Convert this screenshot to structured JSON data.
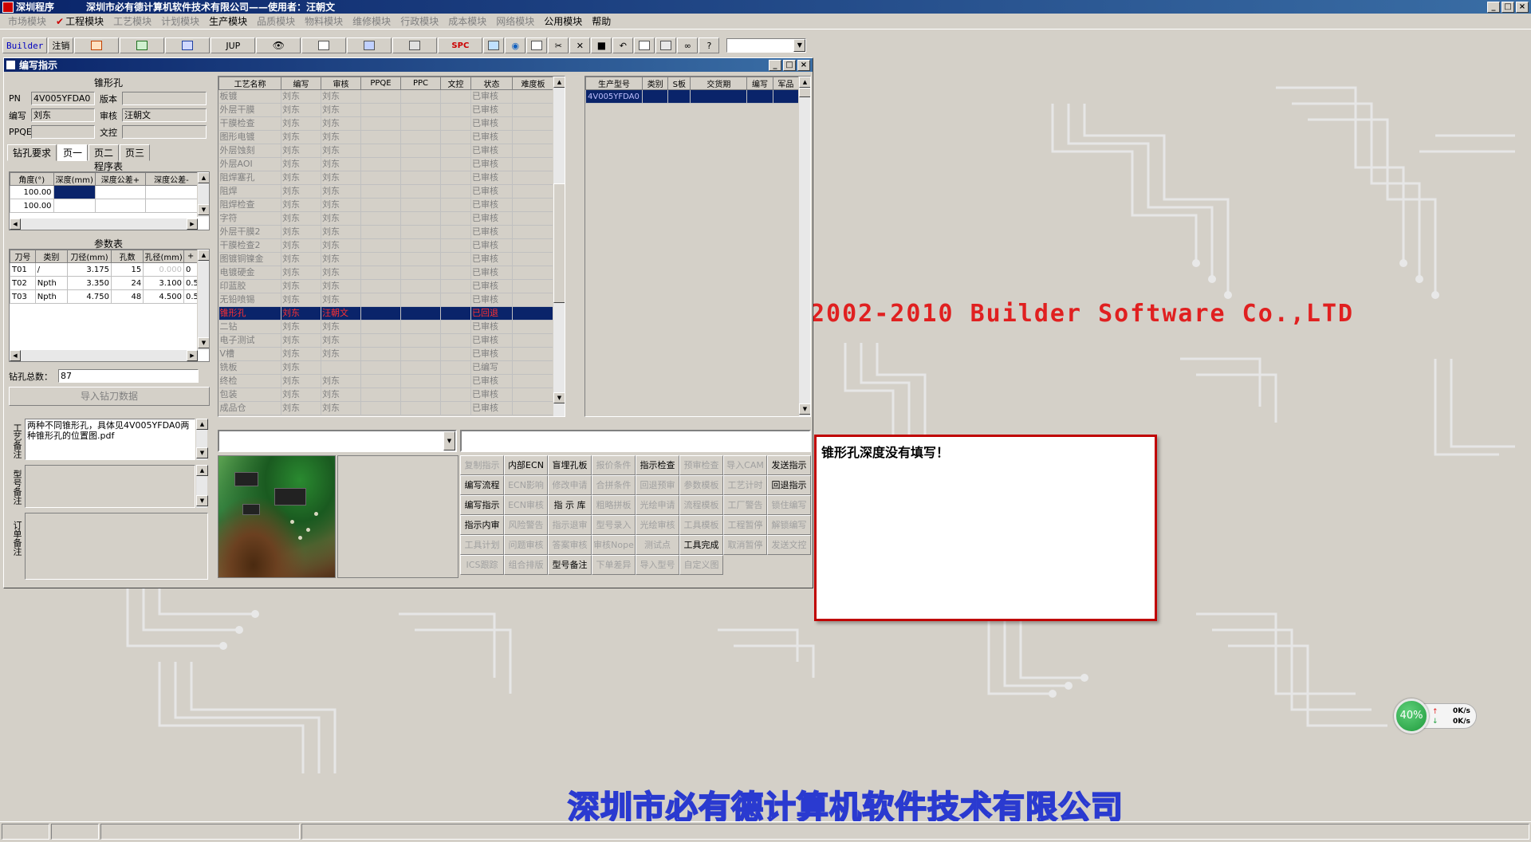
{
  "app": {
    "name": "深圳程序",
    "caption": "深圳市必有德计算机软件技术有限公司——使用者：汪朝文"
  },
  "window_buttons": [
    "_",
    "□",
    "×"
  ],
  "menu": [
    {
      "label": "市场模块",
      "active": false
    },
    {
      "label": "工程模块",
      "active": true,
      "checked": true
    },
    {
      "label": "工艺模块",
      "active": false
    },
    {
      "label": "计划模块",
      "active": false
    },
    {
      "label": "生产模块",
      "active": true
    },
    {
      "label": "品质模块",
      "active": false
    },
    {
      "label": "物料模块",
      "active": false
    },
    {
      "label": "维修模块",
      "active": false
    },
    {
      "label": "行政模块",
      "active": false
    },
    {
      "label": "成本模块",
      "active": false
    },
    {
      "label": "网络模块",
      "active": false
    },
    {
      "label": "公用模块",
      "active": true
    },
    {
      "label": "帮助",
      "active": true
    }
  ],
  "toolbar": {
    "builder_label": "Builder",
    "logout_label": "注销",
    "jup_label": "JUP",
    "spc_label": "SPC"
  },
  "child_window": {
    "title": "编写指示",
    "buttons": [
      "_",
      "□",
      "×"
    ]
  },
  "left": {
    "header": "锥形孔",
    "pn_label": "PN",
    "pn_value": "4V005YFDA0",
    "version_label": "版本",
    "version_value": "",
    "author_label": "编写",
    "author_value": "刘东",
    "reviewer_label": "审核",
    "reviewer_value": "汪朝文",
    "ppqe_label": "PPQE",
    "ppqe_value": "",
    "doc_label": "文控",
    "doc_value": "",
    "tabs": [
      "钻孔要求",
      "页一",
      "页二",
      "页三"
    ],
    "program_table_title": "程序表",
    "program_columns": [
      "角度(°)",
      "深度(mm)",
      "深度公差+",
      "深度公差-"
    ],
    "program_rows": [
      [
        "100.00",
        "",
        "",
        ""
      ],
      [
        "100.00",
        "",
        "",
        ""
      ]
    ],
    "param_table_title": "参数表",
    "param_columns": [
      "刀号",
      "类别",
      "刀径(mm)",
      "孔数",
      "孔径(mm)",
      "+"
    ],
    "param_rows": [
      [
        "T01",
        "/",
        "3.175",
        "15",
        "0.000",
        "0"
      ],
      [
        "T02",
        "Npth",
        "3.350",
        "24",
        "3.100",
        "0.5"
      ],
      [
        "T03",
        "Npth",
        "4.750",
        "48",
        "4.500",
        "0.5"
      ]
    ],
    "total_holes_label": "钻孔总数：",
    "total_holes_value": "87",
    "import_button": "导入钻刀数据",
    "note1_label": "工艺备注",
    "note1_text": "两种不同锥形孔，具体见4V005YFDA0两种锥形孔的位置图.pdf",
    "note2_label": "型号备注",
    "note3_label": "订单备注"
  },
  "process_grid": {
    "columns": [
      "工艺名称",
      "编写",
      "审核",
      "PPQE",
      "PPC",
      "文控",
      "状态",
      "难度板"
    ],
    "rows": [
      [
        "板镀",
        "刘东",
        "刘东",
        "",
        "",
        "",
        "已审核",
        ""
      ],
      [
        "外层干膜",
        "刘东",
        "刘东",
        "",
        "",
        "",
        "已审核",
        ""
      ],
      [
        "干膜检查",
        "刘东",
        "刘东",
        "",
        "",
        "",
        "已审核",
        ""
      ],
      [
        "图形电镀",
        "刘东",
        "刘东",
        "",
        "",
        "",
        "已审核",
        ""
      ],
      [
        "外层蚀刻",
        "刘东",
        "刘东",
        "",
        "",
        "",
        "已审核",
        ""
      ],
      [
        "外层AOI",
        "刘东",
        "刘东",
        "",
        "",
        "",
        "已审核",
        ""
      ],
      [
        "阻焊塞孔",
        "刘东",
        "刘东",
        "",
        "",
        "",
        "已审核",
        ""
      ],
      [
        "阻焊",
        "刘东",
        "刘东",
        "",
        "",
        "",
        "已审核",
        ""
      ],
      [
        "阻焊检查",
        "刘东",
        "刘东",
        "",
        "",
        "",
        "已审核",
        ""
      ],
      [
        "字符",
        "刘东",
        "刘东",
        "",
        "",
        "",
        "已审核",
        ""
      ],
      [
        "外层干膜2",
        "刘东",
        "刘东",
        "",
        "",
        "",
        "已审核",
        ""
      ],
      [
        "干膜检查2",
        "刘东",
        "刘东",
        "",
        "",
        "",
        "已审核",
        ""
      ],
      [
        "图镀铜镍金",
        "刘东",
        "刘东",
        "",
        "",
        "",
        "已审核",
        ""
      ],
      [
        "电镀硬金",
        "刘东",
        "刘东",
        "",
        "",
        "",
        "已审核",
        ""
      ],
      [
        "印蓝胶",
        "刘东",
        "刘东",
        "",
        "",
        "",
        "已审核",
        ""
      ],
      [
        "无铅喷锡",
        "刘东",
        "刘东",
        "",
        "",
        "",
        "已审核",
        ""
      ],
      [
        "锥形孔",
        "刘东",
        "汪朝文",
        "",
        "",
        "",
        "已回退",
        ""
      ],
      [
        "二钻",
        "刘东",
        "刘东",
        "",
        "",
        "",
        "已审核",
        ""
      ],
      [
        "电子测试",
        "刘东",
        "刘东",
        "",
        "",
        "",
        "已审核",
        ""
      ],
      [
        "V槽",
        "刘东",
        "刘东",
        "",
        "",
        "",
        "已审核",
        ""
      ],
      [
        "铣板",
        "刘东",
        "",
        "",
        "",
        "",
        "已编写",
        ""
      ],
      [
        "终检",
        "刘东",
        "刘东",
        "",
        "",
        "",
        "已审核",
        ""
      ],
      [
        "包装",
        "刘东",
        "刘东",
        "",
        "",
        "",
        "已审核",
        ""
      ],
      [
        "成品仓",
        "刘东",
        "刘东",
        "",
        "",
        "",
        "已审核",
        ""
      ]
    ],
    "selected_index": 16
  },
  "model_grid": {
    "columns": [
      "生产型号",
      "类别",
      "S板",
      "交货期",
      "编写",
      "军品"
    ],
    "rows": [
      [
        "4V005YFDA0",
        "",
        "",
        "",
        "",
        ""
      ]
    ]
  },
  "buttons": [
    {
      "label": "复制指示",
      "enabled": false
    },
    {
      "label": "内部ECN",
      "enabled": true
    },
    {
      "label": "盲埋孔板",
      "enabled": true
    },
    {
      "label": "报价条件",
      "enabled": false
    },
    {
      "label": "指示检查",
      "enabled": true
    },
    {
      "label": "预审检查",
      "enabled": false
    },
    {
      "label": "导入CAM",
      "enabled": false
    },
    {
      "label": "发送指示",
      "enabled": true
    },
    {
      "label": "编写流程",
      "enabled": true
    },
    {
      "label": "ECN影响",
      "enabled": false
    },
    {
      "label": "修改申请",
      "enabled": false
    },
    {
      "label": "合拼条件",
      "enabled": false
    },
    {
      "label": "回退预审",
      "enabled": false
    },
    {
      "label": "参数模板",
      "enabled": false
    },
    {
      "label": "工艺计时",
      "enabled": false
    },
    {
      "label": "回退指示",
      "enabled": true
    },
    {
      "label": "编写指示",
      "enabled": true
    },
    {
      "label": "ECN审核",
      "enabled": false
    },
    {
      "label": "指 示 库",
      "enabled": true
    },
    {
      "label": "粗略拼板",
      "enabled": false
    },
    {
      "label": "光绘申请",
      "enabled": false
    },
    {
      "label": "流程模板",
      "enabled": false
    },
    {
      "label": "工厂警告",
      "enabled": false
    },
    {
      "label": "锁住编写",
      "enabled": false
    },
    {
      "label": "指示内审",
      "enabled": true
    },
    {
      "label": "风险警告",
      "enabled": false
    },
    {
      "label": "指示退审",
      "enabled": false
    },
    {
      "label": "型号录入",
      "enabled": false
    },
    {
      "label": "光绘审核",
      "enabled": false
    },
    {
      "label": "工具模板",
      "enabled": false
    },
    {
      "label": "工程暂停",
      "enabled": false
    },
    {
      "label": "解锁编写",
      "enabled": false
    },
    {
      "label": "工具计划",
      "enabled": false
    },
    {
      "label": "问题审核",
      "enabled": false
    },
    {
      "label": "答案审核",
      "enabled": false
    },
    {
      "label": "审核Nope",
      "enabled": false
    },
    {
      "label": "测试点",
      "enabled": false
    },
    {
      "label": "工具完成",
      "enabled": true
    },
    {
      "label": "取消暂停",
      "enabled": false
    },
    {
      "label": "发送文控",
      "enabled": false
    },
    {
      "label": "ICS跟踪",
      "enabled": false
    },
    {
      "label": "组合排版",
      "enabled": false
    },
    {
      "label": "型号备注",
      "enabled": true
    },
    {
      "label": "下单差异",
      "enabled": false
    },
    {
      "label": "导入型号",
      "enabled": false
    },
    {
      "label": "自定义图",
      "enabled": false
    }
  ],
  "message": "锥形孔深度没有填写！",
  "background": {
    "copyright": "2002-2010 Builder Software Co.,LTD",
    "company": "深圳市必有德计算机软件技术有限公司"
  },
  "net_meter": {
    "percent": "40%",
    "up_rate": "0K/s",
    "down_rate": "0K/s"
  },
  "colors": {
    "accent_title": "#0a246a",
    "selection": "#0a246a",
    "message_border": "#c00000",
    "copyright": "#e02020",
    "company": "#2a3ad0"
  }
}
